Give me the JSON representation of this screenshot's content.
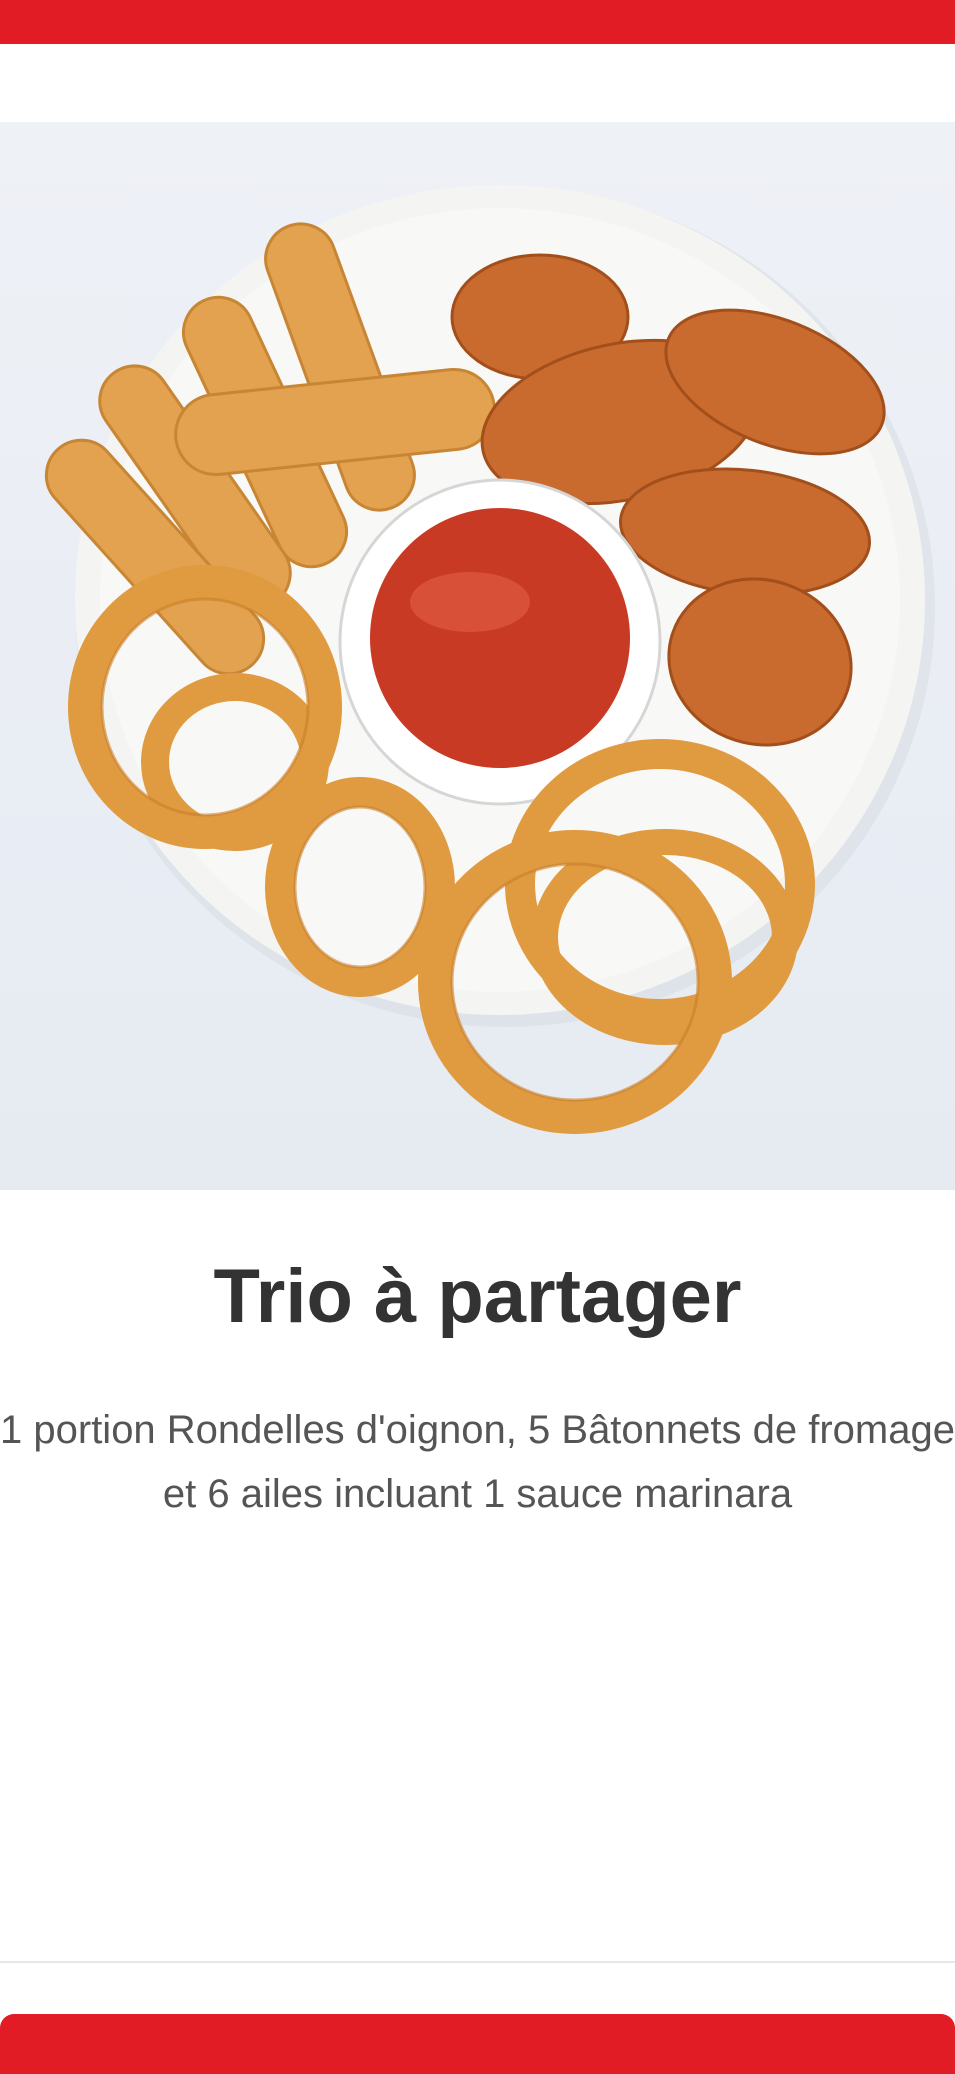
{
  "product": {
    "title": "Trio à partager",
    "description_line1": "1 portion Rondelles d'oignon, 5 Bâtonnets de fromage",
    "description_line2": "et 6 ailes incluant 1 sauce marinara"
  },
  "bottom_button": {
    "label": ""
  },
  "colors": {
    "brand_red": "#e21c24",
    "title_text": "#333333",
    "description_text": "#555555"
  },
  "icons": {
    "hero": "food-photo"
  }
}
